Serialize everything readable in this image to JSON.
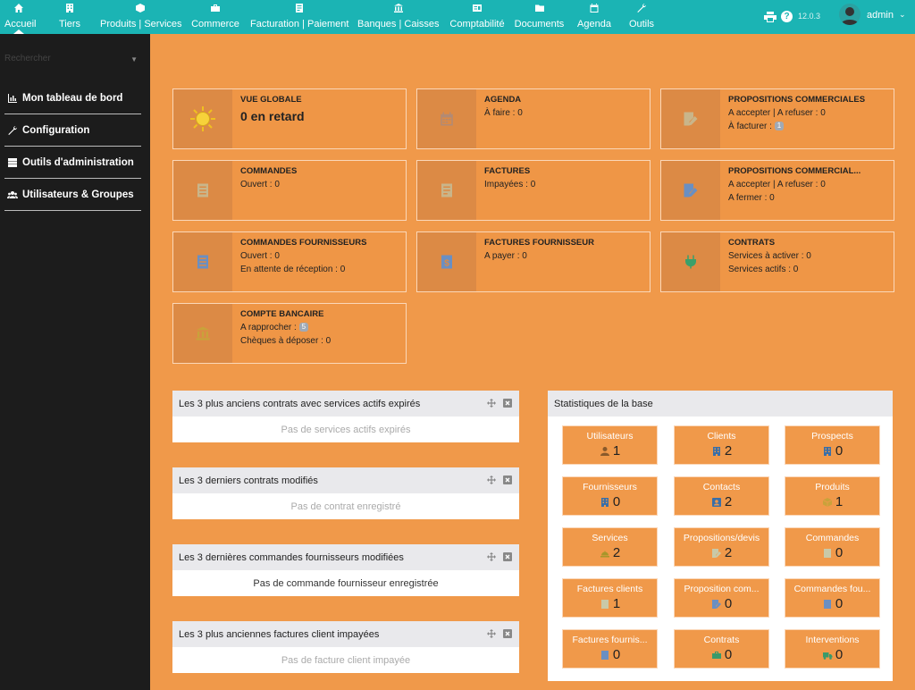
{
  "topnav": {
    "items": [
      {
        "label": "Accueil",
        "icon": "home-icon"
      },
      {
        "label": "Tiers",
        "icon": "building-icon"
      },
      {
        "label": "Produits | Services",
        "icon": "cube-icon"
      },
      {
        "label": "Commerce",
        "icon": "briefcase-icon"
      },
      {
        "label": "Facturation | Paiement",
        "icon": "invoice-icon"
      },
      {
        "label": "Banques | Caisses",
        "icon": "bank-icon"
      },
      {
        "label": "Comptabilité",
        "icon": "ledger-icon"
      },
      {
        "label": "Documents",
        "icon": "folder-icon"
      },
      {
        "label": "Agenda",
        "icon": "calendar-icon"
      },
      {
        "label": "Outils",
        "icon": "wrench-icon"
      }
    ],
    "version": "12.0.3",
    "user": "admin"
  },
  "sidebar": {
    "search_placeholder": "Rechercher",
    "items": [
      {
        "label": "Mon tableau de bord",
        "icon": "chart-icon"
      },
      {
        "label": "Configuration",
        "icon": "wrench-icon"
      },
      {
        "label": "Outils d'administration",
        "icon": "server-icon"
      },
      {
        "label": "Utilisateurs & Groupes",
        "icon": "users-icon"
      }
    ]
  },
  "boxes": {
    "global": {
      "title": "VUE GLOBALE",
      "value": "0 en retard"
    },
    "agenda": {
      "title": "AGENDA",
      "l1": "À faire : 0"
    },
    "propal": {
      "title": "PROPOSITIONS COMMERCIALES",
      "l1": "A accepter | A refuser : 0",
      "l2": "À facturer : ",
      "badge": "1"
    },
    "commandes": {
      "title": "COMMANDES",
      "l1": "Ouvert : 0"
    },
    "factures": {
      "title": "FACTURES",
      "l1": "Impayées : 0"
    },
    "propal2": {
      "title": "PROPOSITIONS COMMERCIAL...",
      "l1": "A accepter | A refuser : 0",
      "l2": "A fermer : 0"
    },
    "cmdfourn": {
      "title": "COMMANDES FOURNISSEURS",
      "l1": "Ouvert : 0",
      "l2": "En attente de réception : 0"
    },
    "factfourn": {
      "title": "FACTURES FOURNISSEUR",
      "l1": "A payer : 0"
    },
    "contrats": {
      "title": "CONTRATS",
      "l1": "Services à activer : 0",
      "l2": "Services actifs : 0"
    },
    "banque": {
      "title": "COMPTE BANCAIRE",
      "l1": "A rapprocher : ",
      "badge": "5",
      "l2": "Chèques à déposer : 0"
    }
  },
  "panels": [
    {
      "title": "Les 3 plus anciens contrats avec services actifs expirés",
      "body": "Pas de services actifs expirés"
    },
    {
      "title": "Les 3 derniers contrats modifiés",
      "body": "Pas de contrat enregistré"
    },
    {
      "title": "Les 3 dernières commandes fournisseurs modifiées",
      "body": "Pas de commande fournisseur enregistrée"
    },
    {
      "title": "Les 3 plus anciennes factures client impayées",
      "body": "Pas de facture client impayée"
    }
  ],
  "stats": {
    "title": "Statistiques de la base",
    "items": [
      {
        "label": "Utilisateurs",
        "value": "1",
        "icon": "user-icon",
        "color": "#8a5a2b"
      },
      {
        "label": "Clients",
        "value": "2",
        "icon": "building-icon",
        "color": "#3a6fa8"
      },
      {
        "label": "Prospects",
        "value": "0",
        "icon": "building-icon",
        "color": "#3a6fa8"
      },
      {
        "label": "Fournisseurs",
        "value": "0",
        "icon": "building-icon",
        "color": "#3a6fa8"
      },
      {
        "label": "Contacts",
        "value": "2",
        "icon": "contact-icon",
        "color": "#3a6fa8"
      },
      {
        "label": "Produits",
        "value": "1",
        "icon": "cube-icon",
        "color": "#c9a23a"
      },
      {
        "label": "Services",
        "value": "2",
        "icon": "service-icon",
        "color": "#a8962a"
      },
      {
        "label": "Propositions/devis",
        "value": "2",
        "icon": "propal-icon",
        "color": "#c9c9a8"
      },
      {
        "label": "Commandes",
        "value": "0",
        "icon": "order-icon",
        "color": "#c9c9a8"
      },
      {
        "label": "Factures clients",
        "value": "1",
        "icon": "bill-icon",
        "color": "#c9c9a8"
      },
      {
        "label": "Proposition com...",
        "value": "0",
        "icon": "propal-icon",
        "color": "#6a8fc2"
      },
      {
        "label": "Commandes fou...",
        "value": "0",
        "icon": "order-icon",
        "color": "#6a8fc2"
      },
      {
        "label": "Factures fournis...",
        "value": "0",
        "icon": "bill-icon",
        "color": "#6a8fc2"
      },
      {
        "label": "Contrats",
        "value": "0",
        "icon": "contract-icon",
        "color": "#3a9a6a"
      },
      {
        "label": "Interventions",
        "value": "0",
        "icon": "truck-icon",
        "color": "#3a9a6a"
      }
    ]
  }
}
